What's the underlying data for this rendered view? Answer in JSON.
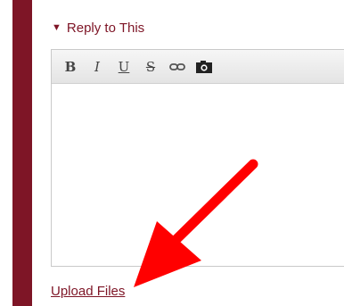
{
  "reply": {
    "toggle_glyph": "▼",
    "label": "Reply to This"
  },
  "toolbar": {
    "bold": "B",
    "italic": "I",
    "underline": "U",
    "strike": "S",
    "link_icon": "link-icon",
    "image_icon": "camera-icon"
  },
  "editor": {
    "value": ""
  },
  "upload": {
    "label": "Upload Files"
  },
  "colors": {
    "accent": "#7e1526",
    "annotation_arrow": "#ff0000"
  }
}
